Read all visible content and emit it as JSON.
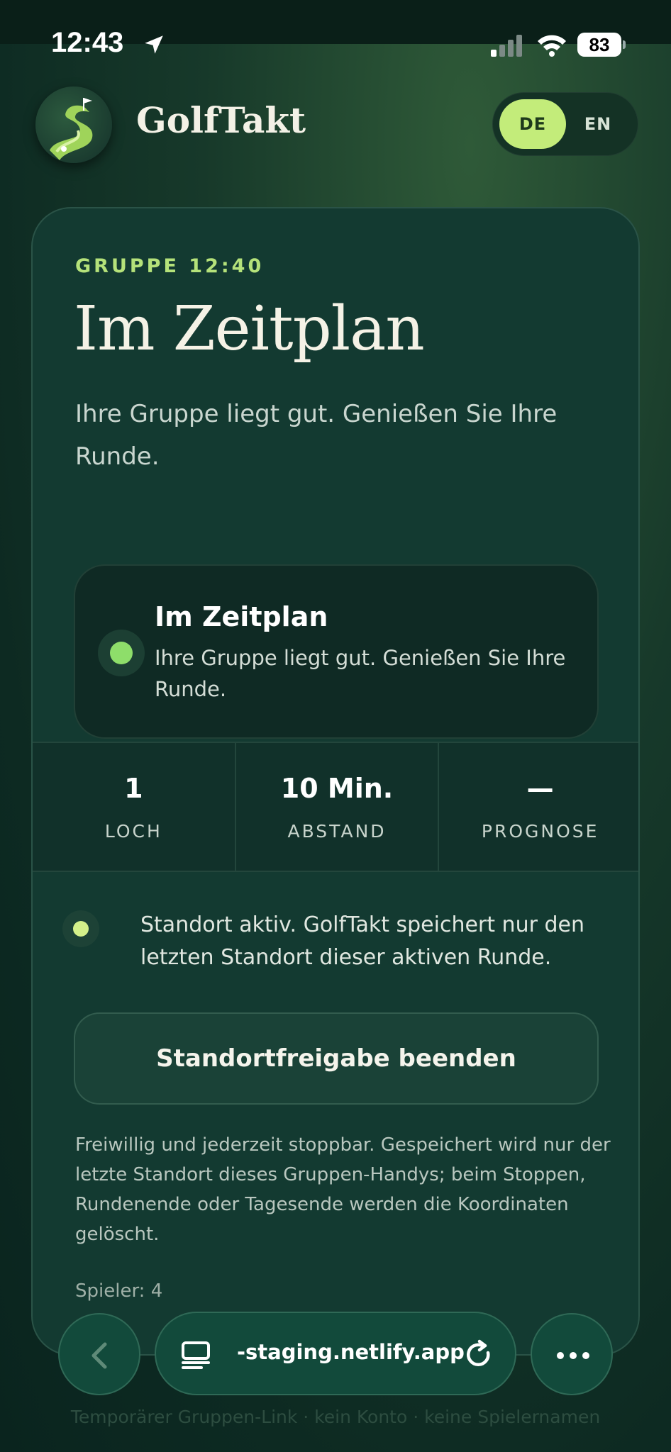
{
  "status_bar": {
    "time": "12:43",
    "battery": "83"
  },
  "header": {
    "brand": "GolfTakt",
    "lang_de": "DE",
    "lang_en": "EN"
  },
  "card": {
    "group_label": "GRUPPE 12:40",
    "headline": "Im Zeitplan",
    "intro": "Ihre Gruppe liegt gut. Genießen Sie Ihre Runde.",
    "status": {
      "title": "Im Zeitplan",
      "description": "Ihre Gruppe liegt gut. Genießen Sie Ihre Runde."
    },
    "metrics": [
      {
        "value": "1",
        "label": "LOCH"
      },
      {
        "value": "10 Min.",
        "label": "ABSTAND"
      },
      {
        "value": "—",
        "label": "PROGNOSE"
      }
    ],
    "location_text": "Standort aktiv. GolfTakt speichert nur den letzten Standort dieser aktiven Runde.",
    "stop_button": "Standortfreigabe beenden",
    "disclaimer": "Freiwillig und jederzeit stoppbar. Gespeichert wird nur der letzte Standort dieses Gruppen-Handys; beim Stoppen, Rundenende oder Tagesende werden die Koordinaten gelöscht.",
    "players": "Spieler: 4"
  },
  "footer_note": "Temporärer Gruppen-Link · kein Konto · keine Spielernamen",
  "browser": {
    "url": "-staging.netlify.app"
  },
  "colors": {
    "accent": "#c3ec7a",
    "status_green": "#8ede6a",
    "card_bg": "#133a31"
  }
}
